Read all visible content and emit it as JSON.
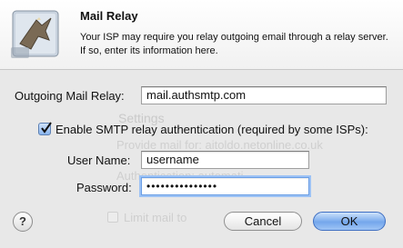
{
  "header": {
    "title": "Mail Relay",
    "description": "Your ISP may require you relay outgoing email through a relay server.  If so, enter its information here."
  },
  "form": {
    "relay_label": "Outgoing Mail Relay:",
    "relay_value": "mail.authsmtp.com",
    "auth_checkbox_label": "Enable SMTP relay authentication (required by some ISPs):",
    "auth_checked": true,
    "username_label": "User Name:",
    "username_value": "username",
    "password_label": "Password:",
    "password_value": "•••••••••••••••"
  },
  "background": {
    "settings_text": "Settings",
    "provide_text": "Provide mail for: aitoldo.netonline.co.uk",
    "auth_text": "Authentication:  automati",
    "limit_text": "Limit mail to"
  },
  "buttons": {
    "help": "?",
    "cancel": "Cancel",
    "ok": "OK"
  },
  "colors": {
    "default_button": "#74a7ec",
    "focus_ring": "#9cc2f5"
  }
}
